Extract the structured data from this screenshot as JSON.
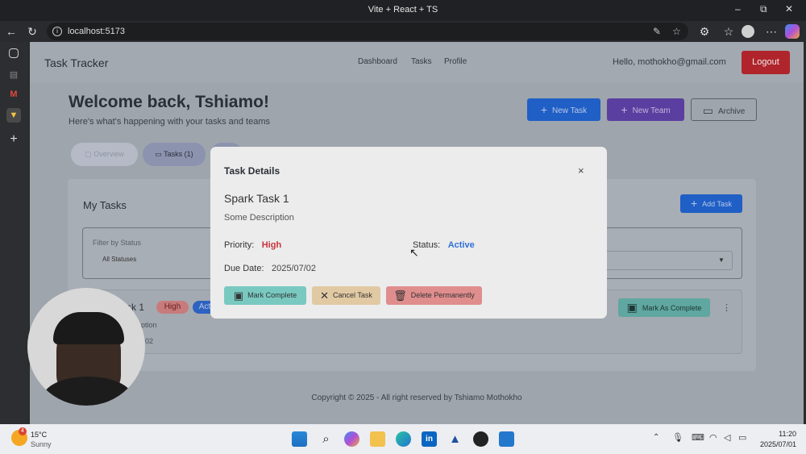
{
  "browser": {
    "tab_title": "Vite + React + TS",
    "url": "localhost:5173",
    "window_controls": {
      "minimize": "–",
      "restore": "⧉",
      "close": "✕"
    }
  },
  "app": {
    "brand": "Task Tracker",
    "nav": [
      "Dashboard",
      "Tasks",
      "Profile"
    ],
    "greeting": "Hello, mothokho@gmail.com",
    "logout_label": "Logout",
    "welcome_title": "Welcome back, Tshiamo!",
    "welcome_subtitle": "Here's what's happening with your tasks and teams",
    "actions": {
      "new_task": "New Task",
      "new_team": "New Team",
      "archive": "Archive"
    },
    "tabs": {
      "overview": "Overview",
      "tasks": "Tasks (1)"
    },
    "my_tasks": {
      "title": "My Tasks",
      "add_task": "Add Task",
      "filter_label": "Filter by Status",
      "filter_value": "All Statuses",
      "row_name_partial": "sk 1",
      "row_priority_badge": "High",
      "row_status_badge_partial": "Act",
      "row_desc_partial": "ption",
      "row_date_partial": "02",
      "mark_as_complete": "Mark As Complete"
    },
    "footer": "Copyright © 2025 - All right reserved by Tshiamo Mothokho"
  },
  "modal": {
    "title": "Task Details",
    "close_icon": "×",
    "task_name": "Spark Task 1",
    "task_description": "Some Description",
    "priority_label": "Priority:",
    "priority_value": "High",
    "status_label": "Status:",
    "status_value": "Active",
    "due_label": "Due Date:",
    "due_value": "2025/07/02",
    "buttons": {
      "mark_complete": "Mark Complete",
      "cancel_task": "Cancel Task",
      "delete": "Delete Permanently"
    }
  },
  "taskbar": {
    "weather_temp": "15°C",
    "weather_desc": "Sunny",
    "weather_badge": "4",
    "time": "11:20",
    "date": "2025/07/01"
  },
  "colors": {
    "primary_blue": "#1f5fc6",
    "purple": "#5b3fa0",
    "logout_red": "#b0252b",
    "priority_red": "#c7343b",
    "status_blue": "#2f6fd6",
    "mark_complete_bg": "#79c9c1",
    "cancel_bg": "#e1c9a3",
    "delete_bg": "#e08d8d"
  }
}
